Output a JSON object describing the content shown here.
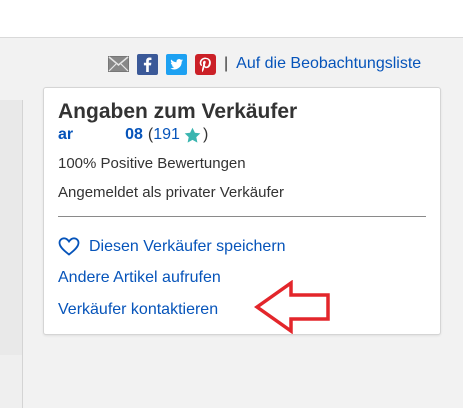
{
  "share": {
    "icons": [
      "email-icon",
      "facebook-icon",
      "twitter-icon",
      "pinterest-icon"
    ],
    "separator": "|",
    "watchlist_label": "Auf die Beobachtungsliste"
  },
  "seller": {
    "heading": "Angaben zum Verkäufer",
    "name_start": "ar",
    "name_end": "08",
    "open_paren": "(",
    "feedback_score": "191",
    "close_paren": ")",
    "positive_feedback": "100% Positive Bewertungen",
    "account_type": "Angemeldet als privater Verkäufer",
    "save_seller_label": "Diesen Verkäufer speichern",
    "other_items_label": "Andere Artikel aufrufen",
    "contact_label": "Verkäufer kontaktieren"
  },
  "colors": {
    "link": "#0654ba",
    "star": "#3ab5b0",
    "arrow": "#e3262b"
  }
}
